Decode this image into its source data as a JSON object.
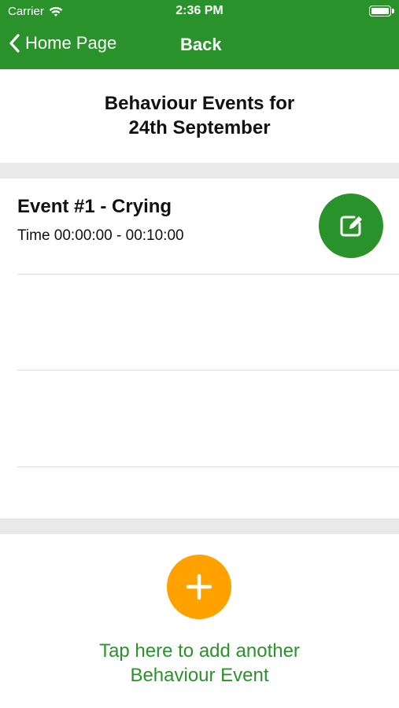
{
  "status_bar": {
    "carrier": "Carrier",
    "time": "2:36 PM"
  },
  "nav": {
    "home_label": "Home Page",
    "back_label": "Back"
  },
  "header": {
    "title_line1": "Behaviour Events for",
    "title_line2": "24th September"
  },
  "events": [
    {
      "title": "Event #1 - Crying",
      "time": "Time 00:00:00 - 00:10:00"
    }
  ],
  "add_event": {
    "line1": "Tap here to add another",
    "line2": "Behaviour Event"
  },
  "colors": {
    "brand_green": "#2a922a",
    "accent_orange": "#ffa200",
    "separator_gray": "#e9e9e9"
  },
  "icons": {
    "edit": "edit-pencil-icon",
    "add": "plus-icon",
    "back": "chevron-left-icon",
    "wifi": "wifi-icon",
    "battery": "battery-icon"
  }
}
